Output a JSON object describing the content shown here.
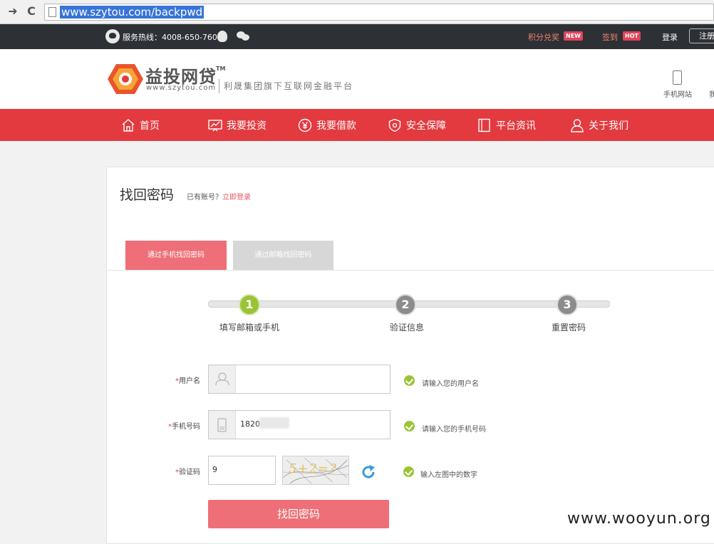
{
  "browser": {
    "back_glyph": "➜",
    "reload_glyph": "C",
    "url": "www.szytou.com/backpwd"
  },
  "topbar": {
    "hotline": "服务热线：4008-650-760",
    "points_exchange": "积分兑奖",
    "new_badge": "NEW",
    "signin": "签到",
    "hot_badge": "HOT",
    "login": "登录",
    "register": "注册"
  },
  "header": {
    "logo_name": "益投网贷",
    "logo_tm": "TM",
    "logo_url": "www.szytou.com",
    "slogan": "利晟集团旗下互联网金融平台",
    "mobile_label": "手机网站",
    "cut_label": "我"
  },
  "nav": {
    "items": [
      {
        "label": "首页",
        "icon": "home-icon"
      },
      {
        "label": "我要投资",
        "icon": "chart-icon"
      },
      {
        "label": "我要借款",
        "icon": "yen-icon"
      },
      {
        "label": "安全保障",
        "icon": "shield-icon"
      },
      {
        "label": "平台资讯",
        "icon": "document-icon"
      },
      {
        "label": "关于我们",
        "icon": "user-icon"
      }
    ]
  },
  "page": {
    "title": "找回密码",
    "has_account": "已有账号？",
    "login_now": "立即登录",
    "tabs": {
      "phone": "通过手机找回密码",
      "email": "通过邮箱找回密码"
    },
    "steps": [
      {
        "number": "1",
        "label": "填写邮箱或手机"
      },
      {
        "number": "2",
        "label": "验证信息"
      },
      {
        "number": "3",
        "label": "重置密码"
      }
    ]
  },
  "form": {
    "username": {
      "required": "*",
      "label": "用户名",
      "value": "",
      "hint": "请输入您的用户名"
    },
    "phone": {
      "required": "*",
      "label": "手机号码",
      "value": "1820",
      "hint": "请输入您的手机号码"
    },
    "captcha": {
      "required": "*",
      "label": "验证码",
      "value": "9",
      "image_text": "5+2=?",
      "hint": "输入左图中的数字"
    },
    "submit_label": "找回密码"
  },
  "watermark": "www.wooyun.org",
  "colors": {
    "brand_red": "#e33a3f",
    "tab_active": "#ee6f77",
    "step_active": "#9bc435",
    "topbar_bg": "#2d3035"
  }
}
